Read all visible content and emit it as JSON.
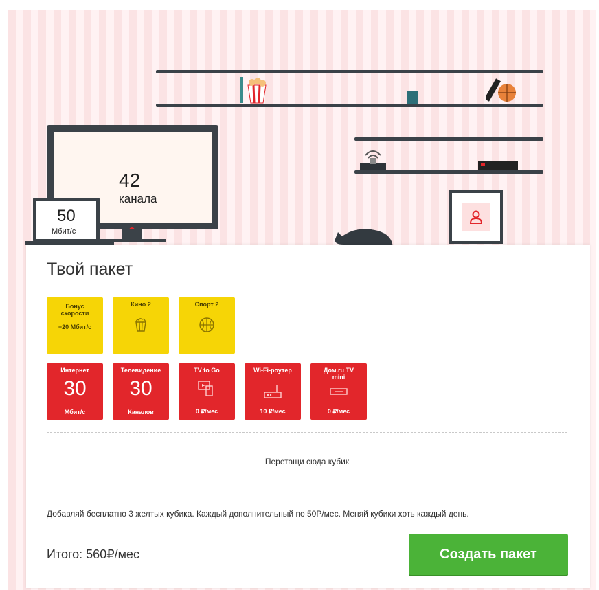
{
  "tv": {
    "number": "42",
    "unit": "канала"
  },
  "laptop": {
    "number": "50",
    "unit": "Мбит/с"
  },
  "package": {
    "title": "Твой пакет",
    "yellow_tiles": [
      {
        "name": "Бонус скорости",
        "sub": "+20 Мбит/с",
        "icon": ""
      },
      {
        "name": "Кино 2",
        "icon": "popcorn-icon"
      },
      {
        "name": "Спорт 2",
        "icon": "ball-icon"
      }
    ],
    "red_tiles": [
      {
        "name": "Интернет",
        "big": "30",
        "foot": "Мбит/с"
      },
      {
        "name": "Телевидение",
        "big": "30",
        "foot": "Каналов"
      },
      {
        "name": "TV to Go",
        "icon": "tv-to-go-icon",
        "foot": "0 ₽/мес"
      },
      {
        "name": "Wi-Fi-роутер",
        "icon": "router-icon",
        "foot": "10 ₽/мес"
      },
      {
        "name": "Дом.ru TV mini",
        "icon": "set-top-box-icon",
        "foot": "0 ₽/мес"
      }
    ],
    "dropzone": "Перетащи сюда кубик",
    "note": "Добавляй бесплатно 3 желтых кубика. Каждый дополнительный по 50Р/мес. Меняй кубики хоть каждый день.",
    "total": "Итого: 560₽/мес",
    "create_button": "Создать пакет"
  },
  "colors": {
    "yellow": "#f6d506",
    "red": "#e2262b",
    "green": "#4bb338",
    "stripe_pink": "#fbe3e4"
  }
}
